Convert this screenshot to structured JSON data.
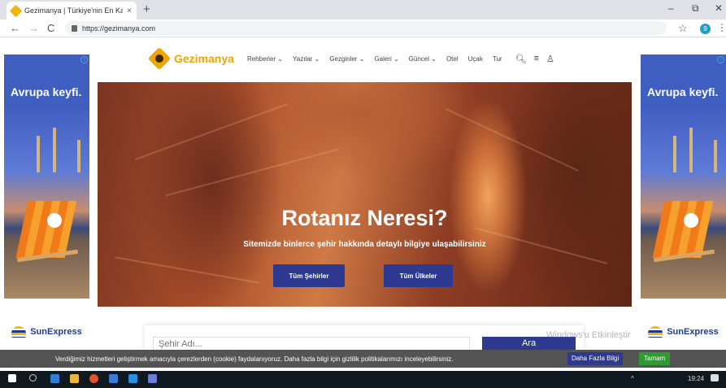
{
  "browser": {
    "tab_title": "Gezimanya | Türkiye'nin En Kapsa",
    "tab_close": "×",
    "new_tab": "+",
    "window_controls": [
      "–",
      "⧉",
      "✕"
    ],
    "back": "←",
    "forward": "→",
    "reload": "C",
    "url": "https://gezimanya.com",
    "star": "☆",
    "profile_initial": "9",
    "menu": "⋮"
  },
  "ads": {
    "headline": "Avrupa keyfi.",
    "brand": "SunExpress",
    "info": "i"
  },
  "nav": {
    "logo": "Gezimanya",
    "items": [
      {
        "label": "Rehberler ⌄"
      },
      {
        "label": "Yazılar ⌄"
      },
      {
        "label": "Gezginler ⌄"
      },
      {
        "label": "Galeri ⌄"
      },
      {
        "label": "Güncel ⌄"
      },
      {
        "label": "Otel"
      },
      {
        "label": "Uçak"
      },
      {
        "label": "Tur"
      }
    ],
    "icons": {
      "search": "🔍︎",
      "menu": "≡",
      "user": "♙"
    }
  },
  "hero": {
    "title": "Rotanız Neresi?",
    "subtitle": "Sitemizde binlerce şehir hakkında detaylı bilgiye ulaşabilirsiniz",
    "btn_cities": "Tüm Şehirler",
    "btn_countries": "Tüm Ülkeler"
  },
  "search": {
    "placeholder": "Şehir Adı...",
    "button": "Ara"
  },
  "watermark": "Windows'u Etkinleştir",
  "cookie": {
    "text": "Verdiğimiz hizmetleri geliştirmek amacıyla çerezlerden (cookie) faydalanıyoruz. Daha fazla bilgi için gizlilik politikalarımızı inceleyebilirsiniz.",
    "more": "Daha Fazla Bilgi",
    "ok": "Tamam"
  },
  "taskbar": {
    "tray": "^",
    "clock": "19:24"
  },
  "colors": {
    "accent": "#2d3a8f",
    "logo": "#f0a500",
    "ok_green": "#2e9b2e"
  }
}
